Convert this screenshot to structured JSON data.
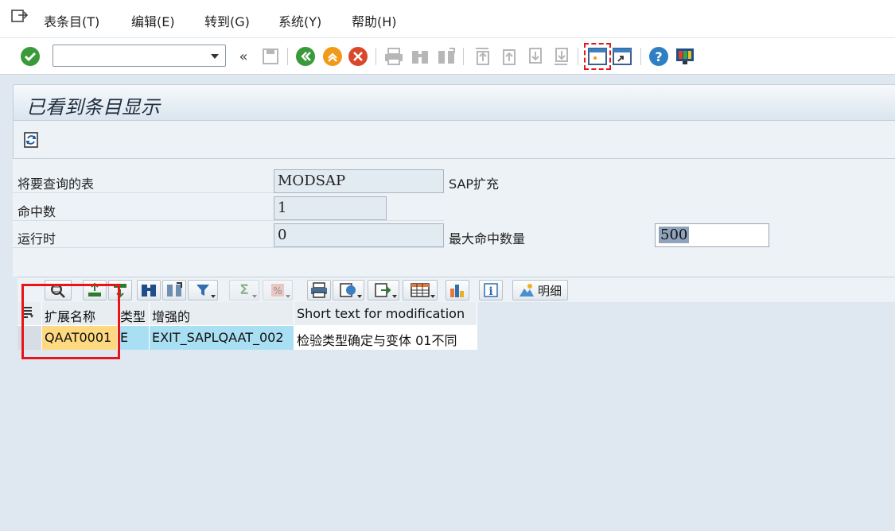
{
  "menu": {
    "items": [
      "表条目(T)",
      "编辑(E)",
      "转到(G)",
      "系统(Y)",
      "帮助(H)"
    ]
  },
  "toolbar": {
    "command_value": "",
    "icons": [
      "enter-icon",
      "back-icon",
      "exit-icon",
      "cancel-icon",
      "print-icon",
      "find-icon",
      "find-next-icon",
      "first-page-icon",
      "prev-page-icon",
      "next-page-icon",
      "last-page-icon",
      "new-session-icon",
      "shortcut-icon",
      "help-icon",
      "customize-layout-icon"
    ]
  },
  "title": "已看到条目显示",
  "form": {
    "table_label": "将要查询的表",
    "table_value": "MODSAP",
    "table_desc": "SAP扩充",
    "hits_label": "命中数",
    "hits_value": "1",
    "runtime_label": "运行时",
    "runtime_value": "0",
    "max_hits_label": "最大命中数量",
    "max_hits_value": "500"
  },
  "alv": {
    "detail_label": "明细",
    "columns": [
      "扩展名称",
      "类型",
      "增强的",
      "Short text for modification"
    ],
    "rows": [
      [
        "QAAT0001",
        "E",
        "EXIT_SAPLQAAT_002",
        "检验类型确定与变体 01不同"
      ]
    ]
  },
  "colors": {
    "highlight_box": "#e8141a",
    "key_cell": "#ffd980",
    "data_cell": "#a9dff3"
  }
}
